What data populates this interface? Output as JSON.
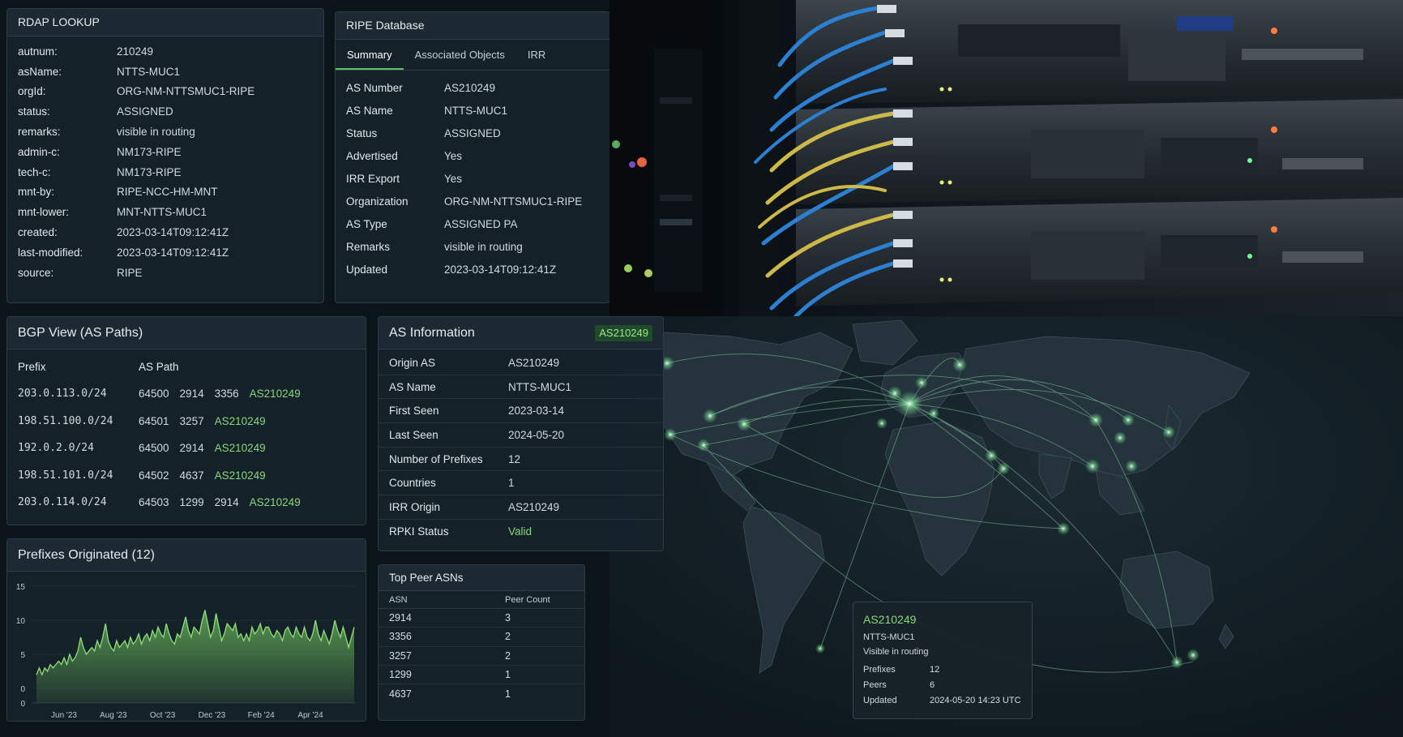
{
  "rdap": {
    "title": "RDAP LOOKUP",
    "rows": [
      {
        "key": "autnum:",
        "value": "210249"
      },
      {
        "key": "asName:",
        "value": "NTTS-MUC1"
      },
      {
        "key": "orgId:",
        "value": "ORG-NM-NTTSMUC1-RIPE"
      },
      {
        "key": "status:",
        "value": "ASSIGNED"
      },
      {
        "key": "remarks:",
        "value": "visible in routing"
      },
      {
        "key": "admin-c:",
        "value": "NM173-RIPE"
      },
      {
        "key": "tech-c:",
        "value": "NM173-RIPE"
      },
      {
        "key": "mnt-by:",
        "value": "RIPE-NCC-HM-MNT"
      },
      {
        "key": "mnt-lower:",
        "value": "MNT-NTTS-MUC1"
      },
      {
        "key": "created:",
        "value": "2023-03-14T09:12:41Z"
      },
      {
        "key": "last-modified:",
        "value": "2023-03-14T09:12:41Z"
      },
      {
        "key": "source:",
        "value": "RIPE"
      }
    ]
  },
  "ripe": {
    "title": "RIPE Database",
    "tabs": [
      "Summary",
      "Associated Objects",
      "IRR"
    ],
    "rows": [
      {
        "key": "AS Number",
        "value": "AS210249"
      },
      {
        "key": "AS Name",
        "value": "NTTS-MUC1"
      },
      {
        "key": "Status",
        "value": "ASSIGNED"
      },
      {
        "key": "Advertised",
        "value": "Yes"
      },
      {
        "key": "IRR Export",
        "value": "Yes"
      },
      {
        "key": "Organization",
        "value": "ORG-NM-NTTSMUC1-RIPE"
      },
      {
        "key": "AS Type",
        "value": "ASSIGNED PA"
      },
      {
        "key": "Remarks",
        "value": "visible in routing"
      },
      {
        "key": "Updated",
        "value": "2023-03-14T09:12:41Z"
      }
    ]
  },
  "bgp": {
    "title": "BGP View (AS Paths)",
    "headers": [
      "Prefix",
      "AS Path"
    ],
    "rows": [
      {
        "prefix": "203.0.113.0/24",
        "path": [
          "64500",
          "2914",
          "3356"
        ],
        "origin": "AS210249"
      },
      {
        "prefix": "198.51.100.0/24",
        "path": [
          "64501",
          "3257"
        ],
        "origin": "AS210249"
      },
      {
        "prefix": "192.0.2.0/24",
        "path": [
          "64500",
          "2914"
        ],
        "origin": "AS210249"
      },
      {
        "prefix": "198.51.101.0/24",
        "path": [
          "64502",
          "4637"
        ],
        "origin": "AS210249"
      },
      {
        "prefix": "203.0.114.0/24",
        "path": [
          "64503",
          "1299",
          "2914"
        ],
        "origin": "AS210249"
      }
    ]
  },
  "prefixes": {
    "title": "Prefixes Originated (12)"
  },
  "chart_data": {
    "type": "area",
    "title": "Prefixes Originated (12)",
    "xlabel": "",
    "ylabel": "",
    "x_ticks": [
      "Jun '23",
      "Aug '23",
      "Oct '23",
      "Dec '23",
      "Feb '24",
      "Apr '24"
    ],
    "y_ticks": [
      "15",
      "10",
      "5",
      "0",
      "0"
    ],
    "ylim": [
      0,
      15
    ],
    "color": "#6fc05e",
    "series": [
      {
        "values": [
          2,
          3,
          2,
          3,
          2.5,
          3.5,
          3,
          3.5,
          4,
          3.5,
          4.5,
          3.5,
          5,
          4,
          4.5,
          5.5,
          7.5,
          6,
          5,
          5.5,
          6,
          5.5,
          7,
          6,
          7.5,
          9.5,
          7,
          6,
          5.5,
          7,
          6,
          6.5,
          7,
          6,
          7.5,
          6.5,
          7,
          8,
          6.5,
          7.5,
          8,
          7,
          8.5,
          7.5,
          9,
          8,
          7.5,
          9.5,
          8,
          7,
          6.5,
          8,
          7.5,
          9,
          10.5,
          8.5,
          7.5,
          9,
          8.5,
          8,
          10,
          11.5,
          9.5,
          7.5,
          8.5,
          11,
          9,
          7,
          8,
          9.5,
          9,
          8.5,
          9.5,
          7.5,
          8,
          7,
          8,
          7,
          9,
          8,
          8.5,
          9.5,
          8,
          9,
          9,
          8,
          7.5,
          8.5,
          8,
          7,
          8.5,
          9,
          8,
          7.5,
          9,
          8,
          7.5,
          9,
          7.5,
          7,
          8,
          10,
          8,
          7,
          8.5,
          7.5,
          6.5,
          8,
          10,
          8.5,
          7.5,
          9,
          7.5,
          6,
          7.5,
          9
        ]
      }
    ]
  },
  "asinfo": {
    "title": "AS Information",
    "badge": "AS210249",
    "rows": [
      {
        "key": "Origin AS",
        "value": "AS210249"
      },
      {
        "key": "AS Name",
        "value": "NTTS-MUC1"
      },
      {
        "key": "First Seen",
        "value": "2023-03-14"
      },
      {
        "key": "Last Seen",
        "value": "2024-05-20"
      },
      {
        "key": "Number of Prefixes",
        "value": "12"
      },
      {
        "key": "Countries",
        "value": "1"
      },
      {
        "key": "IRR Origin",
        "value": "AS210249"
      },
      {
        "key": "RPKI Status",
        "value": "Valid"
      }
    ]
  },
  "peers": {
    "title": "Top Peer ASNs",
    "headers": [
      "ASN",
      "Peer Count"
    ],
    "rows": [
      {
        "asn": "2914",
        "count": "3"
      },
      {
        "asn": "3356",
        "count": "2"
      },
      {
        "asn": "3257",
        "count": "2"
      },
      {
        "asn": "1299",
        "count": "1"
      },
      {
        "asn": "4637",
        "count": "1"
      }
    ]
  },
  "map_tooltip": {
    "title": "AS210249",
    "name": "NTTS-MUC1",
    "status": "Visible in routing",
    "rows": [
      {
        "key": "Prefixes",
        "value": "12"
      },
      {
        "key": "Peers",
        "value": "6"
      },
      {
        "key": "Updated",
        "value": "2024-05-20 14:23 UTC"
      }
    ]
  },
  "colors": {
    "accent_green": "#8bd67e",
    "badge_bg": "#1f4a2c",
    "panel_bg": "#16222a",
    "map_node": "#c8ffd8"
  }
}
